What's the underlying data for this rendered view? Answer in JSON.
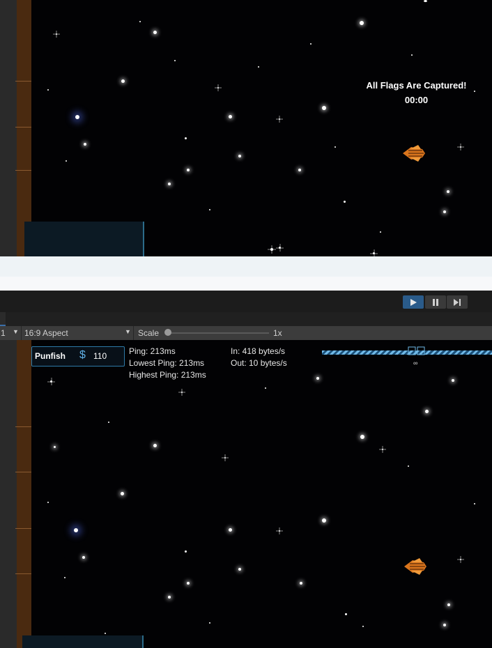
{
  "top_scene": {
    "status_text": "All Flags Are Captured!",
    "timer": "00:00"
  },
  "toolbar": {
    "play_icon": "play-icon",
    "pause_icon": "pause-icon",
    "step_icon": "step-icon",
    "accent_color": "#2a5b8a"
  },
  "game_view_bar": {
    "display_number": "1",
    "aspect": "16:9 Aspect",
    "scale_label": "Scale",
    "scale_value": "1x"
  },
  "hud": {
    "player_name": "Punfish",
    "currency_icon": "dollar-icon",
    "currency_value": "110",
    "ping": "Ping: 213ms",
    "lowest_ping": "Lowest Ping: 213ms",
    "highest_ping": "Highest Ping: 213ms",
    "bytes_in": "In: 418 bytes/s",
    "bytes_out": "Out: 10 bytes/s",
    "flag_count": "∞",
    "flag_bar_color": "#6fb8e6"
  }
}
